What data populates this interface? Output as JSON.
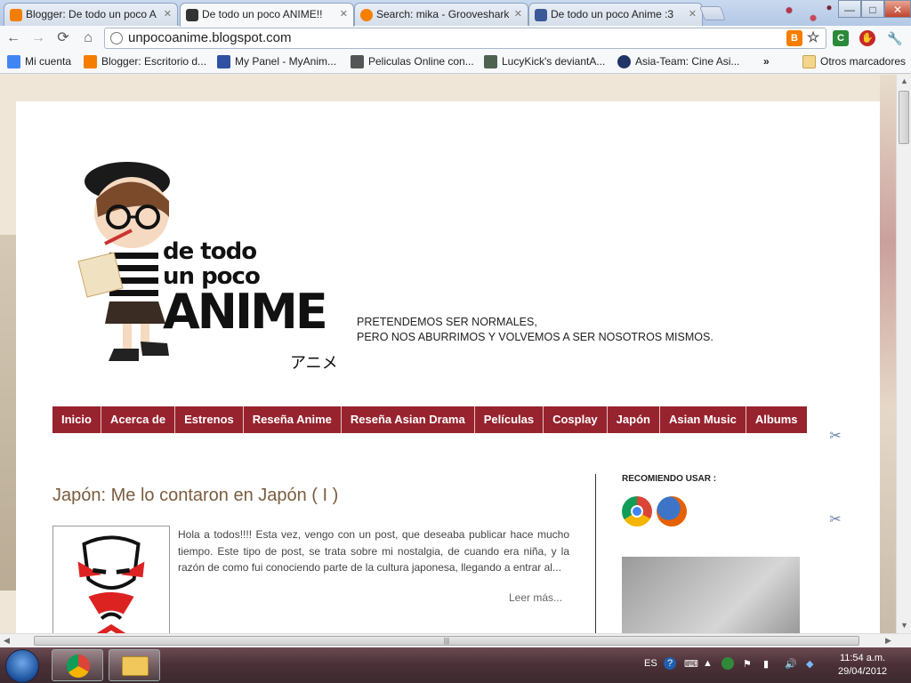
{
  "tabs": [
    {
      "label": "Blogger: De todo un poco A",
      "active": false,
      "icon": "blogger-icon",
      "color": "#f57d00"
    },
    {
      "label": "De todo un poco ANIME!!",
      "active": true,
      "icon": "site-favicon",
      "color": "#333333"
    },
    {
      "label": "Search: mika - Grooveshark",
      "active": false,
      "icon": "grooveshark-icon",
      "color": "#f77f00"
    },
    {
      "label": "De todo un poco Anime :3",
      "active": false,
      "icon": "facebook-icon",
      "color": "#3b5998"
    }
  ],
  "window_controls": {
    "minimize": "—",
    "maximize": "□",
    "close": "✕"
  },
  "toolbar": {
    "back": "←",
    "forward": "→",
    "reload": "⟳",
    "home": "⌂",
    "url": "unpocoanime.blogspot.com",
    "star": "☆",
    "menu": "🔧"
  },
  "bookmarks": [
    {
      "label": "Mi cuenta",
      "icon": "google-icon",
      "color": "#4285f4"
    },
    {
      "label": "Blogger: Escritorio d...",
      "icon": "blogger-icon",
      "color": "#f57d00"
    },
    {
      "label": "My Panel - MyAnim...",
      "icon": "myanimelist-icon",
      "color": "#2e51a2"
    },
    {
      "label": "Peliculas Online con...",
      "icon": "film-icon",
      "color": "#555555"
    },
    {
      "label": "LucyKick's deviantA...",
      "icon": "deviantart-icon",
      "color": "#4e6252"
    },
    {
      "label": "Asia-Team: Cine Asi...",
      "icon": "asia-team-icon",
      "color": "#223366"
    }
  ],
  "bookmarks_overflow": "»",
  "other_bookmarks": "Otros marcadores",
  "header": {
    "logo_line1": "de todo",
    "logo_line2": "un poco",
    "logo_line3": "ANIME",
    "logo_kana": "アニメ",
    "tagline_1": "PRETENDEMOS SER NORMALES,",
    "tagline_2": "PERO NOS ABURRIMOS Y VOLVEMOS A SER NOSOTROS MISMOS."
  },
  "nav": [
    "Inicio",
    "Acerca de",
    "Estrenos",
    "Reseña Anime",
    "Reseña Asian Drama",
    "Películas",
    "Cosplay",
    "Japón",
    "Asian Music",
    "Albums"
  ],
  "post": {
    "title": "Japón: Me lo contaron en Japón ( I )",
    "excerpt": "Hola a todos!!!! Esta vez, vengo con un post, que deseaba publicar hace mucho tiempo. Este tipo de post, se trata sobre mi nostalgia, de cuando era niña, y la razón de como fui conociendo parte de la cultura japonesa, llegando a entrar al...",
    "read_more": "Leer más..."
  },
  "sidebar": {
    "recommend_title": "RECOMIENDO USAR :"
  },
  "taskbar": {
    "language": "ES",
    "time": "11:54 a.m.",
    "date": "29/04/2012"
  },
  "colors": {
    "nav_bg": "#97232e",
    "post_title": "#7a5d3f"
  }
}
